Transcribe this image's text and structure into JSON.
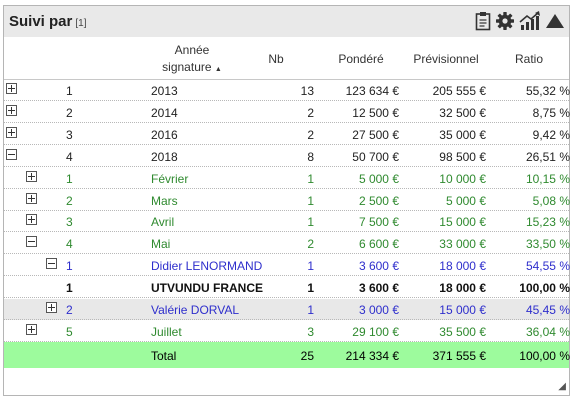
{
  "header": {
    "title": "Suivi par",
    "count": "[1]",
    "icons": [
      "clipboard-icon",
      "gear-icon",
      "chart-trend-icon",
      "collapse-triangle-icon"
    ]
  },
  "columns": {
    "annee_line1": "Année",
    "annee_line2": "signature",
    "nb": "Nb",
    "pondere": "Pondéré",
    "previsionnel": "Prévisionnel",
    "ratio": "Ratio"
  },
  "rows": [
    {
      "level": 0,
      "expander": "plus",
      "idx": "1",
      "label": "2013",
      "nb": "13",
      "pondere": "123 634 €",
      "prev": "205 555 €",
      "ratio": "55,32 %"
    },
    {
      "level": 0,
      "expander": "plus",
      "idx": "2",
      "label": "2014",
      "nb": "2",
      "pondere": "12 500 €",
      "prev": "32 500 €",
      "ratio": "8,75 %"
    },
    {
      "level": 0,
      "expander": "plus",
      "idx": "3",
      "label": "2016",
      "nb": "2",
      "pondere": "27 500 €",
      "prev": "35 000 €",
      "ratio": "9,42 %"
    },
    {
      "level": 0,
      "expander": "minus",
      "idx": "4",
      "label": "2018",
      "nb": "8",
      "pondere": "50 700 €",
      "prev": "98 500 €",
      "ratio": "26,51 %"
    },
    {
      "level": 1,
      "expander": "plus",
      "idx": "1",
      "label": "Février",
      "nb": "1",
      "pondere": "5 000 €",
      "prev": "10 000 €",
      "ratio": "10,15 %"
    },
    {
      "level": 1,
      "expander": "plus",
      "idx": "2",
      "label": "Mars",
      "nb": "1",
      "pondere": "2 500 €",
      "prev": "5 000 €",
      "ratio": "5,08 %"
    },
    {
      "level": 1,
      "expander": "plus",
      "idx": "3",
      "label": "Avril",
      "nb": "1",
      "pondere": "7 500 €",
      "prev": "15 000 €",
      "ratio": "15,23 %"
    },
    {
      "level": 1,
      "expander": "minus",
      "idx": "4",
      "label": "Mai",
      "nb": "2",
      "pondere": "6 600 €",
      "prev": "33 000 €",
      "ratio": "33,50 %"
    },
    {
      "level": 2,
      "expander": "minus",
      "idx": "1",
      "label": "Didier LENORMAND",
      "nb": "1",
      "pondere": "3 600 €",
      "prev": "18 000 €",
      "ratio": "54,55 %"
    },
    {
      "level": 3,
      "expander": "",
      "idx": "1",
      "label": "UTVUNDU FRANCE",
      "nb": "1",
      "pondere": "3 600 €",
      "prev": "18 000 €",
      "ratio": "100,00 %"
    },
    {
      "level": 2,
      "expander": "plus",
      "idx": "2",
      "label": "Valérie DORVAL",
      "nb": "1",
      "pondere": "3 000 €",
      "prev": "15 000 €",
      "ratio": "45,45 %"
    },
    {
      "level": 1,
      "expander": "plus",
      "idx": "5",
      "label": "Juillet",
      "nb": "3",
      "pondere": "29 100 €",
      "prev": "35 500 €",
      "ratio": "36,04 %"
    }
  ],
  "total": {
    "label": "Total",
    "nb": "25",
    "pondere": "214 334 €",
    "prev": "371 555 €",
    "ratio": "100,00 %"
  },
  "colors": {
    "header_bg": "#e9e9e9",
    "total_bg": "#9dfb9d",
    "level1_text": "#2f8a2f",
    "level2_text": "#2e2ecc"
  }
}
